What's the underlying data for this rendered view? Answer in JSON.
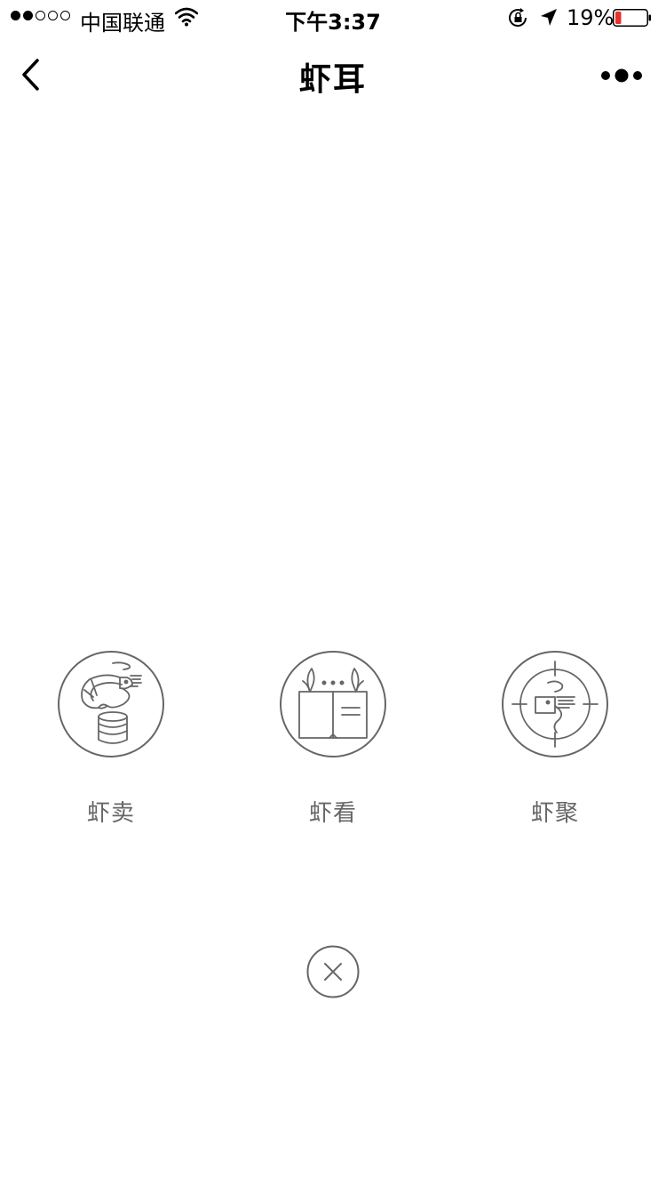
{
  "status_bar": {
    "carrier": "中国联通",
    "time": "下午3:37",
    "battery_percent": "19%",
    "battery_level": 0.19
  },
  "nav": {
    "title": "虾耳"
  },
  "menu": {
    "items": [
      {
        "label": "虾卖",
        "icon": "shrimp-coins-icon"
      },
      {
        "label": "虾看",
        "icon": "open-book-icon"
      },
      {
        "label": "虾聚",
        "icon": "target-shrimp-icon"
      }
    ]
  },
  "colors": {
    "icon_stroke": "#666666",
    "label_text": "#666666",
    "battery_low": "#e8312f"
  }
}
